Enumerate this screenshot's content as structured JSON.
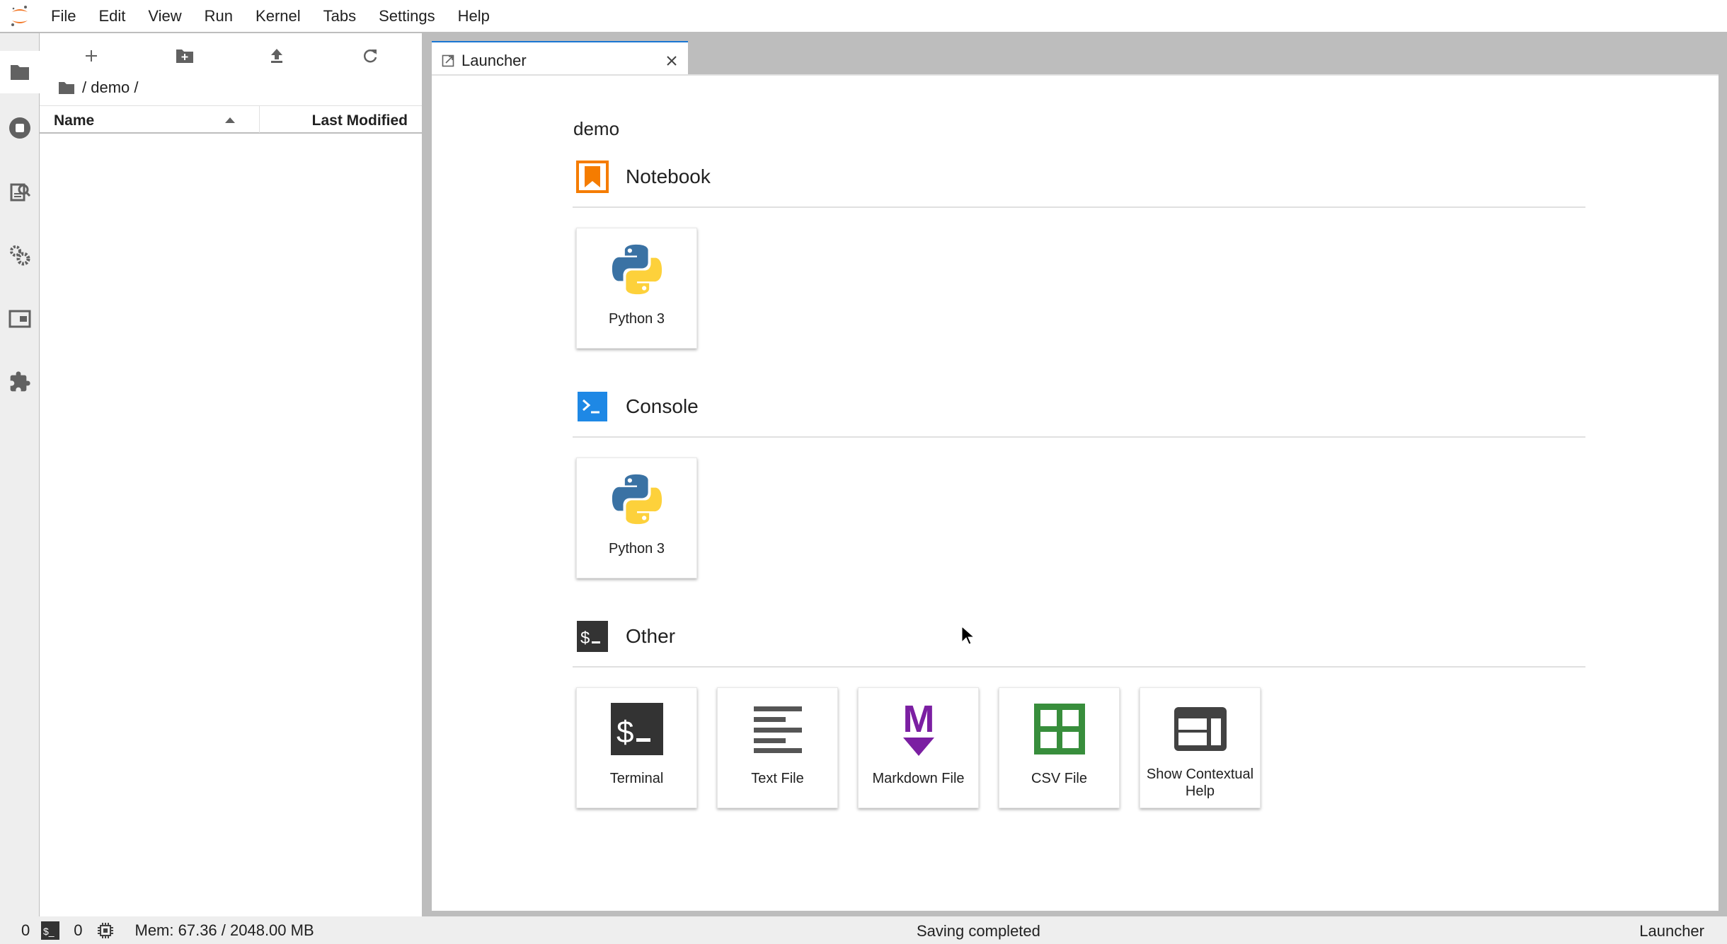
{
  "menu": [
    "File",
    "Edit",
    "View",
    "Run",
    "Kernel",
    "Tabs",
    "Settings",
    "Help"
  ],
  "breadcrumb": "/ demo /",
  "file_list": {
    "col_name": "Name",
    "col_modified": "Last Modified"
  },
  "tab": {
    "label": "Launcher"
  },
  "launcher": {
    "title": "demo",
    "sections": [
      {
        "label": "Notebook",
        "cards": [
          "Python 3"
        ]
      },
      {
        "label": "Console",
        "cards": [
          "Python 3"
        ]
      },
      {
        "label": "Other",
        "cards": [
          "Terminal",
          "Text File",
          "Markdown File",
          "CSV File",
          "Show Contextual Help"
        ]
      }
    ]
  },
  "status": {
    "terminals": "0",
    "kernels": "0",
    "memory": "Mem: 67.36 / 2048.00 MB",
    "message": "Saving completed",
    "mode": "Launcher"
  },
  "colors": {
    "accent": "#1976d2",
    "notebook": "#f57c00",
    "markdown": "#7b1fa2",
    "csv": "#388e3c"
  }
}
